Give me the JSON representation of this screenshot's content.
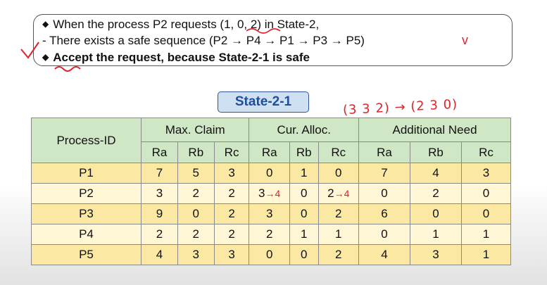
{
  "notes": {
    "line1": "When the process P2 requests (1, 0, 2) in State-2,",
    "line2": "- There exists a safe sequence (P2 → P4 → P1 → P3 → P5)",
    "line3": "Accept the request, because State-2-1 is safe",
    "check_mark": "v"
  },
  "state_title": "State-2-1",
  "handwritten_note": "(3 3 2) → (2 3 0)",
  "table": {
    "process_header": "Process-ID",
    "groups": [
      "Max. Claim",
      "Cur. Alloc.",
      "Additional Need"
    ],
    "sub_headers": [
      "Ra",
      "Rb",
      "Rc",
      "Ra",
      "Rb",
      "Rc",
      "Ra",
      "Rb",
      "Rc"
    ],
    "rows": [
      {
        "pid": "P1",
        "cells": [
          "7",
          "5",
          "3",
          "0",
          "1",
          "0",
          "7",
          "4",
          "3"
        ]
      },
      {
        "pid": "P2",
        "cells": [
          "3",
          "2",
          "2",
          "3",
          "0",
          "2",
          "0",
          "2",
          "0"
        ]
      },
      {
        "pid": "P3",
        "cells": [
          "9",
          "0",
          "2",
          "3",
          "0",
          "2",
          "6",
          "0",
          "0"
        ]
      },
      {
        "pid": "P4",
        "cells": [
          "2",
          "2",
          "2",
          "2",
          "1",
          "1",
          "0",
          "1",
          "1"
        ]
      },
      {
        "pid": "P5",
        "cells": [
          "4",
          "3",
          "3",
          "0",
          "0",
          "2",
          "4",
          "3",
          "1"
        ]
      }
    ],
    "p2_annotations": {
      "ra": "→4",
      "rc": "→4"
    }
  },
  "colors": {
    "ink_red": "#e0222b",
    "header_green": "#cfe7c5",
    "row_yellow": "#fbe8a3",
    "row_light": "#fff6d6",
    "title_blue": "#cfe0f3"
  }
}
